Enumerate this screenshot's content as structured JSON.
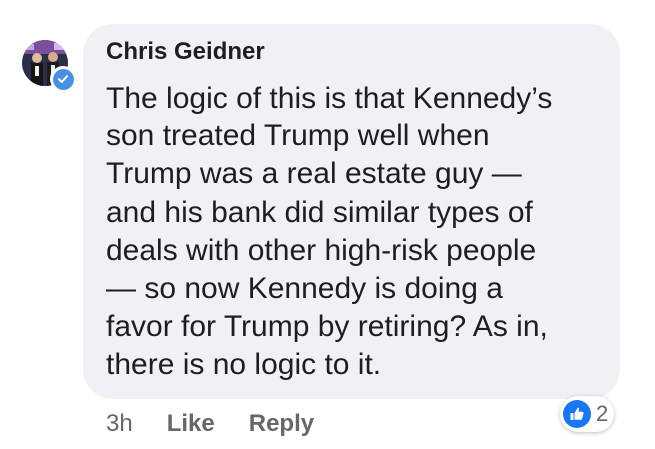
{
  "comment": {
    "author": "Chris Geidner",
    "lines": [
      "The logic of this is that Kennedy’s",
      "son treated Trump well when",
      "Trump was a real estate guy —",
      "and his bank did similar types of",
      "deals with other high-risk people",
      "— so now Kennedy is doing a",
      "favor for Trump by retiring? As in,",
      "there is no logic to it."
    ],
    "timestamp": "3h",
    "like_label": "Like",
    "reply_label": "Reply",
    "reaction_count": "2"
  },
  "icons": {
    "verified": "verified-check-icon",
    "reaction": "thumbs-up-icon"
  },
  "colors": {
    "bubble": "#f0f1f4",
    "text": "#1c1e21",
    "meta": "#65676b",
    "like_blue": "#1877f2",
    "verified_blue": "#4a90e2"
  }
}
